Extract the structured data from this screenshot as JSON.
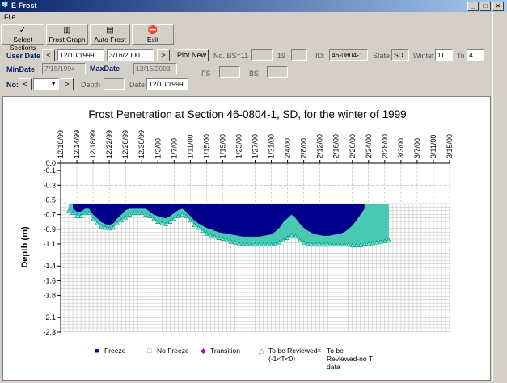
{
  "window": {
    "title": "E-Frost",
    "min": "_",
    "max": "□",
    "close": "×"
  },
  "menu": {
    "file": "File"
  },
  "toolbar": [
    {
      "label": "Select Sections",
      "icon": "✓",
      "name": "select-sections-button",
      "left": 1,
      "width": 54
    },
    {
      "label": "Frost Graph",
      "icon": "▥",
      "name": "frost-graph-button",
      "left": 57,
      "width": 52
    },
    {
      "label": "Auto Frost",
      "icon": "▤",
      "name": "auto-frost-button",
      "left": 111,
      "width": 50
    },
    {
      "label": "Exit",
      "icon": "⛔",
      "name": "exit-button",
      "left": 163,
      "width": 52
    }
  ],
  "controls": {
    "user_date_label": "User Date",
    "user_date_start": "12/10/1999",
    "user_date_end": "3/16/2000",
    "prev": "<",
    "next": ">",
    "plot_new": "Plot New",
    "min_date_label": "MinDate",
    "min_date": "7/15/1994",
    "max_date_label": "MaxDate",
    "max_date": "12/16/2003",
    "no_bs_label": "No. BS=11",
    "no_bs_extra": "19",
    "fs_label": "FS",
    "bs_label": "BS",
    "id_label": "ID:",
    "id_value": "46-0804-1",
    "state_label": "State",
    "state_value": "SD",
    "winter_label": "Winter",
    "winter_value": "11",
    "to_label": "To",
    "to_value": "4",
    "no_label": "No:",
    "depth_label": "Depth",
    "date_label": "Date",
    "date_value": "12/10/1999"
  },
  "chart_data": {
    "type": "heatmap",
    "title": "Frost Penetration at Section 46-0804-1, SD, for the winter of 1999",
    "ylabel": "Depth (m)",
    "x_tick_labels": [
      "12/10/99",
      "12/14/99",
      "12/18/99",
      "12/22/99",
      "12/26/99",
      "12/30/99",
      "1/3/00",
      "1/7/00",
      "1/11/00",
      "1/15/00",
      "1/19/00",
      "1/23/00",
      "1/27/00",
      "1/31/00",
      "2/4/00",
      "2/8/00",
      "2/12/00",
      "2/16/00",
      "2/20/00",
      "2/24/00",
      "2/28/00",
      "3/3/00",
      "3/7/00",
      "3/11/00",
      "3/15/00"
    ],
    "x_days": [
      0,
      4,
      8,
      12,
      16,
      20,
      24,
      28,
      32,
      36,
      40,
      44,
      48,
      52,
      56,
      60,
      64,
      68,
      72,
      76,
      80,
      84,
      88,
      92,
      96
    ],
    "y_ticks": [
      0.0,
      -0.1,
      -0.3,
      -0.5,
      -0.7,
      -0.9,
      -1.1,
      -1.4,
      -1.6,
      -1.8,
      -2.1,
      -2.3
    ],
    "y_tick_labels": [
      "0.0",
      "-0.1",
      "-0.3",
      "-0.5",
      "-0.7",
      "-0.9",
      "-1.1",
      "-1.4",
      "-1.6",
      "-1.8",
      "-2.1",
      "-2.3"
    ],
    "depth_range": [
      0,
      -2.3
    ],
    "sensor_top": -0.55,
    "data_end_day": 82,
    "legend": [
      {
        "label": "Freeze",
        "symbol": "■",
        "color": "#00008b"
      },
      {
        "label": "No Freeze",
        "symbol": "□",
        "color": "#888888"
      },
      {
        "label": "Transition",
        "symbol": "◆",
        "color": "#c000c0"
      },
      {
        "label": "To be Reviewed",
        "label2": "(-1<T<0)",
        "symbol": "△",
        "color": "#20b2aa"
      },
      {
        "label": "To be",
        "label2": "Reviewed-no T",
        "label3": "data",
        "symbol": "×",
        "color": "#444444"
      }
    ],
    "freeze_profile": [
      [
        0,
        null
      ],
      [
        2,
        null
      ],
      [
        3,
        -0.62
      ],
      [
        4,
        -0.66
      ],
      [
        5,
        -0.66
      ],
      [
        6,
        -0.62
      ],
      [
        7,
        -0.62
      ],
      [
        8,
        -0.7
      ],
      [
        9,
        -0.75
      ],
      [
        10,
        -0.8
      ],
      [
        11,
        -0.83
      ],
      [
        12,
        -0.84
      ],
      [
        13,
        -0.82
      ],
      [
        14,
        -0.75
      ],
      [
        15,
        -0.7
      ],
      [
        16,
        -0.64
      ],
      [
        17,
        -0.62
      ],
      [
        18,
        -0.62
      ],
      [
        19,
        -0.62
      ],
      [
        20,
        -0.62
      ],
      [
        21,
        -0.62
      ],
      [
        22,
        -0.66
      ],
      [
        23,
        -0.7
      ],
      [
        24,
        -0.72
      ],
      [
        25,
        -0.74
      ],
      [
        26,
        -0.75
      ],
      [
        27,
        -0.72
      ],
      [
        28,
        -0.68
      ],
      [
        29,
        -0.64
      ],
      [
        30,
        -0.62
      ],
      [
        31,
        -0.66
      ],
      [
        32,
        -0.72
      ],
      [
        33,
        -0.78
      ],
      [
        34,
        -0.82
      ],
      [
        35,
        -0.85
      ],
      [
        36,
        -0.88
      ],
      [
        37,
        -0.9
      ],
      [
        38,
        -0.92
      ],
      [
        39,
        -0.94
      ],
      [
        40,
        -0.95
      ],
      [
        41,
        -0.96
      ],
      [
        42,
        -0.97
      ],
      [
        43,
        -0.98
      ],
      [
        44,
        -0.99
      ],
      [
        45,
        -1.0
      ],
      [
        46,
        -1.0
      ],
      [
        47,
        -1.0
      ],
      [
        48,
        -1.0
      ],
      [
        49,
        -1.0
      ],
      [
        50,
        -0.99
      ],
      [
        51,
        -0.98
      ],
      [
        52,
        -0.97
      ],
      [
        53,
        -0.93
      ],
      [
        54,
        -0.88
      ],
      [
        55,
        -0.8
      ],
      [
        56,
        -0.75
      ],
      [
        57,
        -0.7
      ],
      [
        58,
        -0.75
      ],
      [
        59,
        -0.82
      ],
      [
        60,
        -0.88
      ],
      [
        61,
        -0.92
      ],
      [
        62,
        -0.95
      ],
      [
        63,
        -0.97
      ],
      [
        64,
        -0.98
      ],
      [
        65,
        -0.99
      ],
      [
        66,
        -0.99
      ],
      [
        67,
        -0.98
      ],
      [
        68,
        -0.97
      ],
      [
        69,
        -0.96
      ],
      [
        70,
        -0.94
      ],
      [
        71,
        -0.9
      ],
      [
        72,
        -0.85
      ],
      [
        73,
        -0.78
      ],
      [
        74,
        -0.7
      ],
      [
        75,
        -0.62
      ],
      [
        76,
        null
      ],
      [
        82,
        null
      ]
    ],
    "review_profile": [
      [
        0,
        null
      ],
      [
        2,
        -0.65
      ],
      [
        3,
        -0.68
      ],
      [
        4,
        -0.72
      ],
      [
        5,
        -0.72
      ],
      [
        6,
        -0.68
      ],
      [
        7,
        -0.68
      ],
      [
        8,
        -0.76
      ],
      [
        9,
        -0.82
      ],
      [
        10,
        -0.86
      ],
      [
        11,
        -0.88
      ],
      [
        12,
        -0.89
      ],
      [
        13,
        -0.88
      ],
      [
        14,
        -0.82
      ],
      [
        15,
        -0.78
      ],
      [
        16,
        -0.74
      ],
      [
        17,
        -0.7
      ],
      [
        18,
        -0.68
      ],
      [
        19,
        -0.68
      ],
      [
        20,
        -0.68
      ],
      [
        21,
        -0.7
      ],
      [
        22,
        -0.72
      ],
      [
        23,
        -0.76
      ],
      [
        24,
        -0.8
      ],
      [
        25,
        -0.82
      ],
      [
        26,
        -0.83
      ],
      [
        27,
        -0.8
      ],
      [
        28,
        -0.76
      ],
      [
        29,
        -0.72
      ],
      [
        30,
        -0.7
      ],
      [
        31,
        -0.72
      ],
      [
        32,
        -0.78
      ],
      [
        33,
        -0.84
      ],
      [
        34,
        -0.88
      ],
      [
        35,
        -0.92
      ],
      [
        36,
        -0.96
      ],
      [
        37,
        -0.98
      ],
      [
        38,
        -1.0
      ],
      [
        39,
        -1.02
      ],
      [
        40,
        -1.03
      ],
      [
        41,
        -1.05
      ],
      [
        42,
        -1.07
      ],
      [
        43,
        -1.08
      ],
      [
        44,
        -1.09
      ],
      [
        45,
        -1.1
      ],
      [
        46,
        -1.1
      ],
      [
        47,
        -1.11
      ],
      [
        48,
        -1.11
      ],
      [
        49,
        -1.11
      ],
      [
        50,
        -1.11
      ],
      [
        51,
        -1.11
      ],
      [
        52,
        -1.11
      ],
      [
        53,
        -1.1
      ],
      [
        54,
        -1.08
      ],
      [
        55,
        -1.05
      ],
      [
        56,
        -1.02
      ],
      [
        57,
        -0.98
      ],
      [
        58,
        -1.0
      ],
      [
        59,
        -1.05
      ],
      [
        60,
        -1.08
      ],
      [
        61,
        -1.1
      ],
      [
        62,
        -1.11
      ],
      [
        63,
        -1.11
      ],
      [
        64,
        -1.11
      ],
      [
        65,
        -1.11
      ],
      [
        66,
        -1.11
      ],
      [
        67,
        -1.11
      ],
      [
        68,
        -1.11
      ],
      [
        69,
        -1.11
      ],
      [
        70,
        -1.11
      ],
      [
        71,
        -1.11
      ],
      [
        72,
        -1.12
      ],
      [
        73,
        -1.12
      ],
      [
        74,
        -1.12
      ],
      [
        75,
        -1.1
      ],
      [
        76,
        -1.1
      ],
      [
        77,
        -1.09
      ],
      [
        78,
        -1.08
      ],
      [
        79,
        -1.07
      ],
      [
        80,
        -1.06
      ],
      [
        81,
        -1.05
      ],
      [
        82,
        null
      ]
    ]
  }
}
